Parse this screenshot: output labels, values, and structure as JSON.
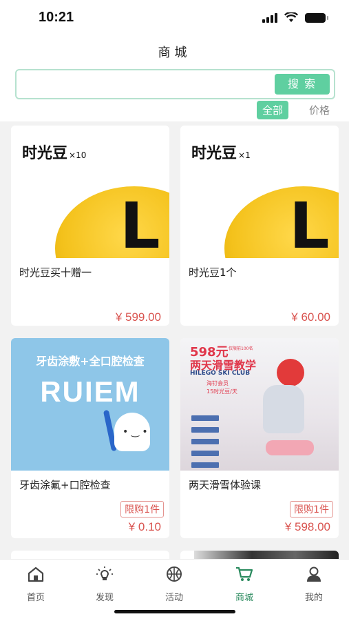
{
  "status_bar": {
    "time": "10:21"
  },
  "header": {
    "title": "商城"
  },
  "search": {
    "value": "",
    "placeholder": "",
    "button_label": "搜索"
  },
  "filters": [
    {
      "label": "全部",
      "active": true
    },
    {
      "label": "价格",
      "active": false
    }
  ],
  "products": [
    {
      "name": "时光豆买十赠一",
      "price": "¥ 599.00",
      "image": {
        "title": "时光豆",
        "qty": "×10",
        "letter": "L"
      }
    },
    {
      "name": "时光豆1个",
      "price": "¥ 60.00",
      "image": {
        "title": "时光豆",
        "qty": "×1",
        "letter": "L"
      }
    },
    {
      "name": "牙齿涂氟+口腔检查",
      "price": "¥ 0.10",
      "tag": "限购1件",
      "image": {
        "heading": "牙齿涂敷+全口腔检查",
        "brand": "RUIEM"
      }
    },
    {
      "name": "两天滑雪体验课",
      "price": "¥ 598.00",
      "tag": "限购1件",
      "image": {
        "price_title": "598元",
        "price_sub": "仅限前100名",
        "title": "两天滑雪教学",
        "club": "HILEGO SKI CLUB",
        "member_line1": "海钉会员",
        "member_line2": "15时光豆/天"
      }
    }
  ],
  "tab_bar": [
    {
      "label": "首页",
      "icon": "home-icon",
      "active": false
    },
    {
      "label": "发现",
      "icon": "lightbulb-icon",
      "active": false
    },
    {
      "label": "活动",
      "icon": "basketball-icon",
      "active": false
    },
    {
      "label": "商城",
      "icon": "cart-icon",
      "active": true
    },
    {
      "label": "我的",
      "icon": "user-icon",
      "active": false
    }
  ],
  "colors": {
    "accent": "#5fcfa0",
    "price": "#d9534f",
    "active_tab": "#2a8a5e"
  }
}
